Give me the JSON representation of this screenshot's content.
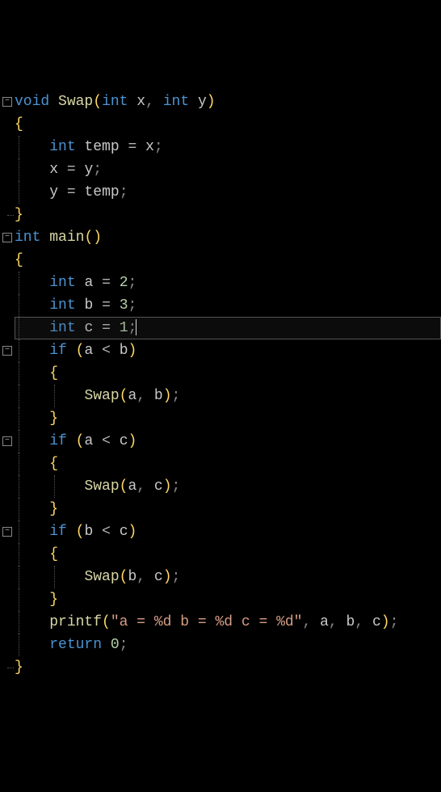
{
  "code": {
    "lines": [
      {
        "fold": "minus",
        "tokens": [
          [
            "kw",
            "void"
          ],
          [
            "sp",
            " "
          ],
          [
            "fn",
            "Swap"
          ],
          [
            "br",
            "("
          ],
          [
            "kw",
            "int"
          ],
          [
            "sp",
            " "
          ],
          [
            "id",
            "x"
          ],
          [
            "pn",
            ","
          ],
          [
            "sp",
            " "
          ],
          [
            "kw",
            "int"
          ],
          [
            "sp",
            " "
          ],
          [
            "id",
            "y"
          ],
          [
            "br",
            ")"
          ]
        ]
      },
      {
        "guide": "mid",
        "tokens": [
          [
            "br",
            "{"
          ]
        ]
      },
      {
        "guide": "mid",
        "tokens": [
          [
            "iguide",
            " "
          ],
          [
            "sp",
            "   "
          ],
          [
            "kw",
            "int"
          ],
          [
            "sp",
            " "
          ],
          [
            "id",
            "temp"
          ],
          [
            "sp",
            " "
          ],
          [
            "op",
            "="
          ],
          [
            "sp",
            " "
          ],
          [
            "id",
            "x"
          ],
          [
            "pn",
            ";"
          ]
        ]
      },
      {
        "guide": "mid",
        "tokens": [
          [
            "iguide",
            " "
          ],
          [
            "sp",
            "   "
          ],
          [
            "id",
            "x"
          ],
          [
            "sp",
            " "
          ],
          [
            "op",
            "="
          ],
          [
            "sp",
            " "
          ],
          [
            "id",
            "y"
          ],
          [
            "pn",
            ";"
          ]
        ]
      },
      {
        "guide": "mid",
        "tokens": [
          [
            "iguide",
            " "
          ],
          [
            "sp",
            "   "
          ],
          [
            "id",
            "y"
          ],
          [
            "sp",
            " "
          ],
          [
            "op",
            "="
          ],
          [
            "sp",
            " "
          ],
          [
            "id",
            "temp"
          ],
          [
            "pn",
            ";"
          ]
        ]
      },
      {
        "guide": "end",
        "tokens": [
          [
            "br",
            "}"
          ]
        ]
      },
      {
        "fold": "minus",
        "tokens": [
          [
            "kw",
            "int"
          ],
          [
            "sp",
            " "
          ],
          [
            "fn",
            "main"
          ],
          [
            "br",
            "("
          ],
          [
            "br",
            ")"
          ]
        ]
      },
      {
        "guide": "mid",
        "tokens": [
          [
            "br",
            "{"
          ]
        ]
      },
      {
        "guide": "mid",
        "tokens": [
          [
            "iguide",
            " "
          ],
          [
            "sp",
            "   "
          ],
          [
            "kw",
            "int"
          ],
          [
            "sp",
            " "
          ],
          [
            "id",
            "a"
          ],
          [
            "sp",
            " "
          ],
          [
            "op",
            "="
          ],
          [
            "sp",
            " "
          ],
          [
            "num",
            "2"
          ],
          [
            "pn",
            ";"
          ]
        ]
      },
      {
        "guide": "mid",
        "tokens": [
          [
            "iguide",
            " "
          ],
          [
            "sp",
            "   "
          ],
          [
            "kw",
            "int"
          ],
          [
            "sp",
            " "
          ],
          [
            "id",
            "b"
          ],
          [
            "sp",
            " "
          ],
          [
            "op",
            "="
          ],
          [
            "sp",
            " "
          ],
          [
            "num",
            "3"
          ],
          [
            "pn",
            ";"
          ]
        ]
      },
      {
        "guide": "mid",
        "current": true,
        "tokens": [
          [
            "iguide",
            " "
          ],
          [
            "sp",
            "   "
          ],
          [
            "kw",
            "int"
          ],
          [
            "sp",
            " "
          ],
          [
            "id",
            "c"
          ],
          [
            "sp",
            " "
          ],
          [
            "op",
            "="
          ],
          [
            "sp",
            " "
          ],
          [
            "num",
            "1"
          ],
          [
            "pn",
            ";"
          ],
          [
            "caret",
            ""
          ]
        ]
      },
      {
        "fold": "minus",
        "tokens": [
          [
            "iguide",
            " "
          ],
          [
            "sp",
            "   "
          ],
          [
            "kw",
            "if"
          ],
          [
            "sp",
            " "
          ],
          [
            "br",
            "("
          ],
          [
            "id",
            "a"
          ],
          [
            "sp",
            " "
          ],
          [
            "op",
            "<"
          ],
          [
            "sp",
            " "
          ],
          [
            "id",
            "b"
          ],
          [
            "br",
            ")"
          ]
        ]
      },
      {
        "guide": "mid",
        "tokens": [
          [
            "iguide",
            " "
          ],
          [
            "sp",
            "   "
          ],
          [
            "br",
            "{"
          ]
        ]
      },
      {
        "guide": "mid",
        "tokens": [
          [
            "iguide",
            " "
          ],
          [
            "sp",
            "   "
          ],
          [
            "iguide",
            " "
          ],
          [
            "sp",
            "   "
          ],
          [
            "fn",
            "Swap"
          ],
          [
            "br",
            "("
          ],
          [
            "id",
            "a"
          ],
          [
            "pn",
            ","
          ],
          [
            "sp",
            " "
          ],
          [
            "id",
            "b"
          ],
          [
            "br",
            ")"
          ],
          [
            "pn",
            ";"
          ]
        ]
      },
      {
        "guide": "mid",
        "tokens": [
          [
            "iguide",
            " "
          ],
          [
            "sp",
            "   "
          ],
          [
            "br",
            "}"
          ]
        ]
      },
      {
        "fold": "minus",
        "tokens": [
          [
            "iguide",
            " "
          ],
          [
            "sp",
            "   "
          ],
          [
            "kw",
            "if"
          ],
          [
            "sp",
            " "
          ],
          [
            "br",
            "("
          ],
          [
            "id",
            "a"
          ],
          [
            "sp",
            " "
          ],
          [
            "op",
            "<"
          ],
          [
            "sp",
            " "
          ],
          [
            "id",
            "c"
          ],
          [
            "br",
            ")"
          ]
        ]
      },
      {
        "guide": "mid",
        "tokens": [
          [
            "iguide",
            " "
          ],
          [
            "sp",
            "   "
          ],
          [
            "br",
            "{"
          ]
        ]
      },
      {
        "guide": "mid",
        "tokens": [
          [
            "iguide",
            " "
          ],
          [
            "sp",
            "   "
          ],
          [
            "iguide",
            " "
          ],
          [
            "sp",
            "   "
          ],
          [
            "fn",
            "Swap"
          ],
          [
            "br",
            "("
          ],
          [
            "id",
            "a"
          ],
          [
            "pn",
            ","
          ],
          [
            "sp",
            " "
          ],
          [
            "id",
            "c"
          ],
          [
            "br",
            ")"
          ],
          [
            "pn",
            ";"
          ]
        ]
      },
      {
        "guide": "mid",
        "tokens": [
          [
            "iguide",
            " "
          ],
          [
            "sp",
            "   "
          ],
          [
            "br",
            "}"
          ]
        ]
      },
      {
        "fold": "minus",
        "tokens": [
          [
            "iguide",
            " "
          ],
          [
            "sp",
            "   "
          ],
          [
            "kw",
            "if"
          ],
          [
            "sp",
            " "
          ],
          [
            "br",
            "("
          ],
          [
            "id",
            "b"
          ],
          [
            "sp",
            " "
          ],
          [
            "op",
            "<"
          ],
          [
            "sp",
            " "
          ],
          [
            "id",
            "c"
          ],
          [
            "br",
            ")"
          ]
        ]
      },
      {
        "guide": "mid",
        "tokens": [
          [
            "iguide",
            " "
          ],
          [
            "sp",
            "   "
          ],
          [
            "br",
            "{"
          ]
        ]
      },
      {
        "guide": "mid",
        "tokens": [
          [
            "iguide",
            " "
          ],
          [
            "sp",
            "   "
          ],
          [
            "iguide",
            " "
          ],
          [
            "sp",
            "   "
          ],
          [
            "fn",
            "Swap"
          ],
          [
            "br",
            "("
          ],
          [
            "id",
            "b"
          ],
          [
            "pn",
            ","
          ],
          [
            "sp",
            " "
          ],
          [
            "id",
            "c"
          ],
          [
            "br",
            ")"
          ],
          [
            "pn",
            ";"
          ]
        ]
      },
      {
        "guide": "mid",
        "tokens": [
          [
            "iguide",
            " "
          ],
          [
            "sp",
            "   "
          ],
          [
            "br",
            "}"
          ]
        ]
      },
      {
        "guide": "mid",
        "tokens": [
          [
            "iguide",
            " "
          ],
          [
            "sp",
            "   "
          ],
          [
            "fn",
            "printf"
          ],
          [
            "br",
            "("
          ],
          [
            "str",
            "\"a = %d b = %d c = %d\""
          ],
          [
            "pn",
            ","
          ],
          [
            "sp",
            " "
          ],
          [
            "id",
            "a"
          ],
          [
            "pn",
            ","
          ],
          [
            "sp",
            " "
          ],
          [
            "id",
            "b"
          ],
          [
            "pn",
            ","
          ],
          [
            "sp",
            " "
          ],
          [
            "id",
            "c"
          ],
          [
            "br",
            ")"
          ],
          [
            "pn",
            ";"
          ]
        ]
      },
      {
        "guide": "mid",
        "tokens": [
          [
            "iguide",
            " "
          ],
          [
            "sp",
            "   "
          ],
          [
            "kw",
            "return"
          ],
          [
            "sp",
            " "
          ],
          [
            "num",
            "0"
          ],
          [
            "pn",
            ";"
          ]
        ]
      },
      {
        "guide": "end",
        "tokens": [
          [
            "br",
            "}"
          ]
        ]
      }
    ]
  }
}
